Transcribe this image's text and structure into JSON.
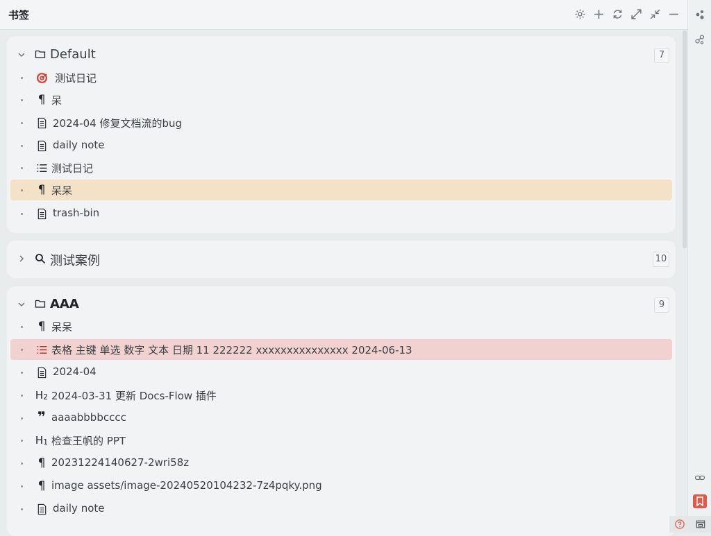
{
  "panel": {
    "title": "书签"
  },
  "groups": [
    {
      "label": "Default",
      "count": "7",
      "expanded": true,
      "items": [
        {
          "icon": "target-emoji-icon",
          "label": "测试日记"
        },
        {
          "icon": "paragraph-icon",
          "label": "呆"
        },
        {
          "icon": "document-icon",
          "label": "2024-04 修复文档流的bug"
        },
        {
          "icon": "document-icon",
          "label": "daily note"
        },
        {
          "icon": "list-icon",
          "label": "测试日记"
        },
        {
          "icon": "paragraph-icon",
          "label": "呆呆",
          "highlight": "orange"
        },
        {
          "icon": "document-icon",
          "label": "trash-bin"
        }
      ]
    },
    {
      "label": "测试案例",
      "count": "10",
      "expanded": false
    },
    {
      "label": "AAA",
      "count": "9",
      "expanded": true,
      "items": [
        {
          "icon": "paragraph-icon",
          "label": "呆呆"
        },
        {
          "icon": "list-icon",
          "label": "表格 主键 单选 数字 文本 日期 11 222222 xxxxxxxxxxxxxxx 2024-06-13",
          "highlight": "red"
        },
        {
          "icon": "document-icon",
          "label": "2024-04"
        },
        {
          "icon": "heading2-icon",
          "label": "2024-03-31 更新 Docs-Flow 插件"
        },
        {
          "icon": "quote-icon",
          "label": "aaaabbbbcccc"
        },
        {
          "icon": "heading1-icon",
          "label": "检查王帆的 PPT"
        },
        {
          "icon": "paragraph-icon",
          "label": "20231224140627-2wri58z"
        },
        {
          "icon": "paragraph-icon",
          "label": "image assets/image-20240520104232-7z4pqky.png"
        },
        {
          "icon": "document-icon",
          "label": "daily note"
        }
      ]
    }
  ],
  "colors": {
    "highlight_orange": "#f4e2c8",
    "highlight_red": "#f2d2d1",
    "accent": "#e05a4a"
  }
}
